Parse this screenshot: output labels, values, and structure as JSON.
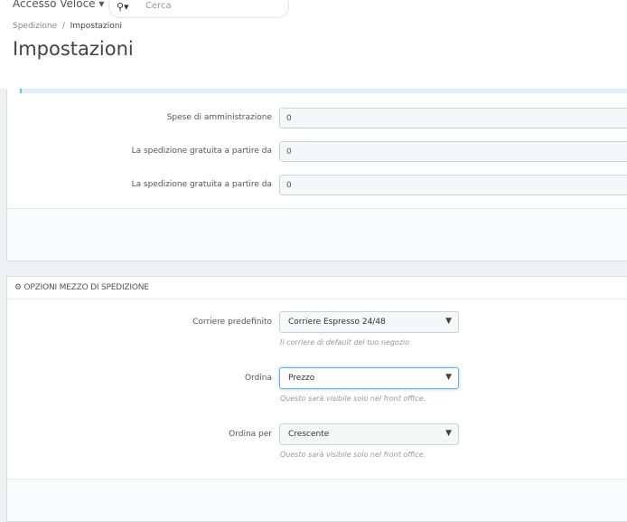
{
  "header": {
    "quick_access": "Accesso Veloce",
    "search_placeholder": "Cerca",
    "search_icon": "search-icon"
  },
  "breadcrumb": {
    "parent": "Spedizione",
    "separator": "/",
    "current": "Impostazioni"
  },
  "page_title": "Impostazioni",
  "fees_panel": {
    "fields": [
      {
        "label": "Spese di amministrazione",
        "value": "0"
      },
      {
        "label": "La spedizione gratuita a partire da",
        "value": "0"
      },
      {
        "label": "La spedizione gratuita a partire da",
        "value": "0"
      }
    ]
  },
  "carrier_panel": {
    "title": "OPZIONI MEZZO DI SPEDIZIONE",
    "icon": "cogs-icon",
    "fields": [
      {
        "label": "Corriere predefinito",
        "value": "Corriere Espresso 24/48",
        "help": "Il corriere di default del tuo negozio"
      },
      {
        "label": "Ordina",
        "value": "Prezzo",
        "help": "Questo sarà visibile solo nel front office."
      },
      {
        "label": "Ordina per",
        "value": "Crescente",
        "help": "Questo sarà visibile solo nel front office."
      }
    ]
  }
}
